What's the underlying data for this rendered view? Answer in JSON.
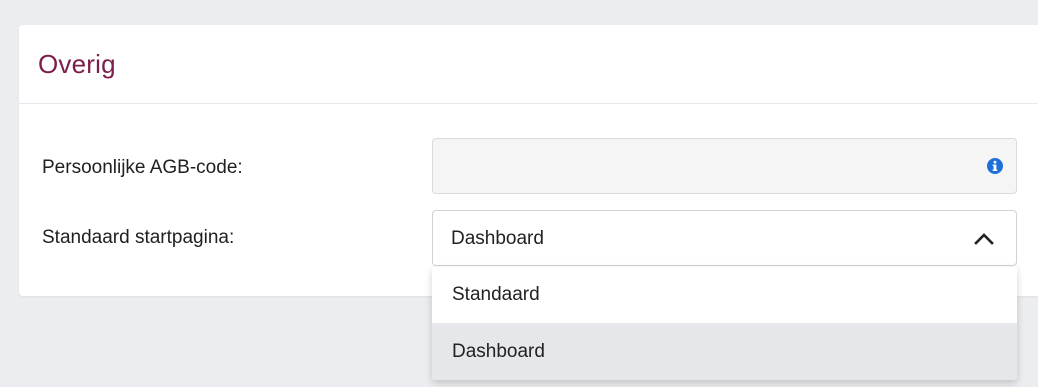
{
  "section": {
    "title": "Overig"
  },
  "fields": {
    "agb": {
      "label": "Persoonlijke AGB-code:",
      "value": "",
      "placeholder": "",
      "icon": "info-icon"
    },
    "startpage": {
      "label": "Standaard startpagina:",
      "selected": "Dashboard",
      "icon": "chevron-up-icon",
      "expanded": true,
      "options": [
        {
          "label": "Standaard",
          "selected": false
        },
        {
          "label": "Dashboard",
          "selected": true
        }
      ]
    }
  },
  "colors": {
    "title": "#7b1e4b",
    "info_icon": "#1e6fd9",
    "page_background": "#ecedf0",
    "selected_option": "#e6e7ea"
  }
}
